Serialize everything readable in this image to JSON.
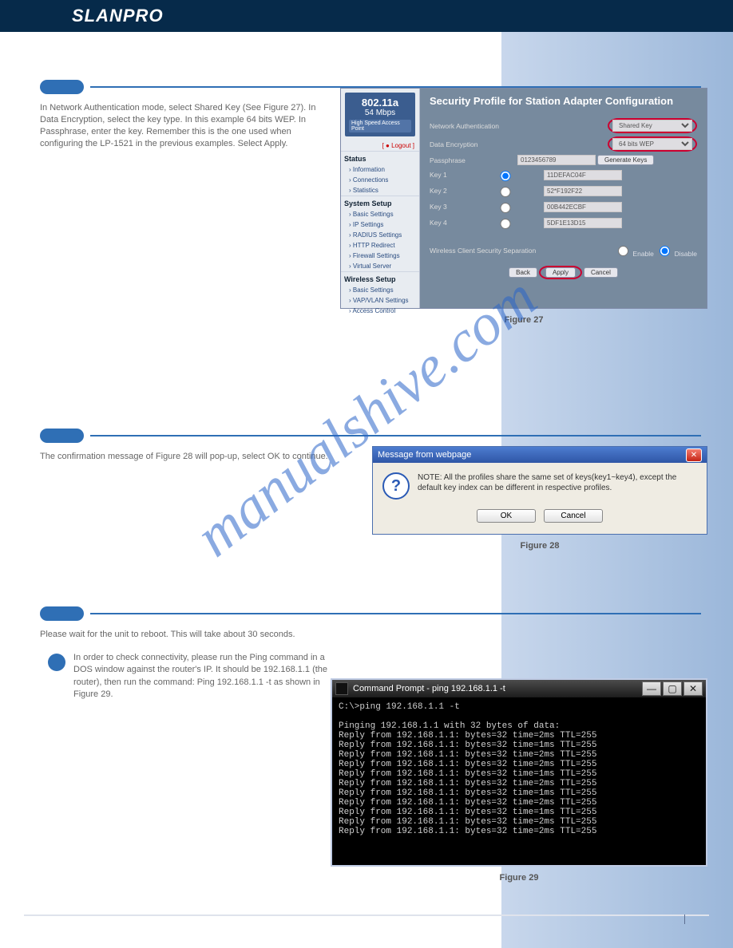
{
  "brand": "SLANPRO",
  "watermark": "manualshive.com",
  "step27": {
    "text": "In Network Authentication mode, select Shared Key (See Figure 27). In Data Encryption, select the key type. In this example 64 bits WEP. In Passphrase, enter the key. Remember this is the one used when configuring the LP-1521 in the previous examples. Select Apply.",
    "figlabel": "Figure 27"
  },
  "step28": {
    "text": "The confirmation message of Figure 28 will pop-up, select OK to continue.",
    "figlabel": "Figure 28"
  },
  "step29": {
    "text": "Please wait for the unit to reboot. This will take about 30 seconds.",
    "figlabel": "Figure 29"
  },
  "step30": {
    "text": "In order to check connectivity, please run the Ping command in a DOS window against the router's IP. It should be 192.168.1.1 (the router), then run the command: Ping 192.168.1.1 -t as shown in Figure 29."
  },
  "fig1": {
    "title": "Security Profile for Station Adapter Configuration",
    "badge": {
      "t1": "802.11a",
      "t2": "54 Mbps",
      "t3": "High Speed Access Point"
    },
    "logout": "[ ● Logout ]",
    "groups": [
      {
        "title": "Status",
        "items": [
          "Information",
          "Connections",
          "Statistics"
        ]
      },
      {
        "title": "System Setup",
        "items": [
          "Basic Settings",
          "IP Settings",
          "RADIUS Settings",
          "HTTP Redirect",
          "Firewall Settings",
          "Virtual Server"
        ]
      },
      {
        "title": "Wireless Setup",
        "items": [
          "Basic Settings",
          "VAP/VLAN Settings",
          "Access Control"
        ]
      }
    ],
    "labels": {
      "netauth": "Network Authentication",
      "dataenc": "Data Encryption",
      "pass": "Passphrase",
      "wcs": "Wireless Client Security Separation",
      "enable": "Enable",
      "disable": "Disable"
    },
    "values": {
      "netauth": "Shared Key",
      "dataenc": "64 bits WEP",
      "pass": "0123456789",
      "keys": [
        "11DEFAC04F",
        "52*F192F22",
        "00B442ECBF",
        "5DF1E13D15"
      ],
      "keylabel": [
        "Key 1",
        "Key 2",
        "Key 3",
        "Key 4"
      ]
    },
    "btns": {
      "gen": "Generate Keys",
      "back": "Back",
      "apply": "Apply",
      "cancel": "Cancel"
    }
  },
  "fig2": {
    "title": "Message from webpage",
    "msg": "NOTE: All the profiles share the same set of keys(key1~key4), except the default key index can be different in respective profiles.",
    "ok": "OK",
    "cancel": "Cancel"
  },
  "fig3": {
    "title": "Command Prompt - ping 192.168.1.1 -t",
    "lines": [
      "C:\\>ping 192.168.1.1 -t",
      "",
      "Pinging 192.168.1.1 with 32 bytes of data:",
      "Reply from 192.168.1.1: bytes=32 time=2ms TTL=255",
      "Reply from 192.168.1.1: bytes=32 time=1ms TTL=255",
      "Reply from 192.168.1.1: bytes=32 time=2ms TTL=255",
      "Reply from 192.168.1.1: bytes=32 time=2ms TTL=255",
      "Reply from 192.168.1.1: bytes=32 time=1ms TTL=255",
      "Reply from 192.168.1.1: bytes=32 time=2ms TTL=255",
      "Reply from 192.168.1.1: bytes=32 time=1ms TTL=255",
      "Reply from 192.168.1.1: bytes=32 time=2ms TTL=255",
      "Reply from 192.168.1.1: bytes=32 time=1ms TTL=255",
      "Reply from 192.168.1.1: bytes=32 time=2ms TTL=255",
      "Reply from 192.168.1.1: bytes=32 time=2ms TTL=255"
    ]
  }
}
